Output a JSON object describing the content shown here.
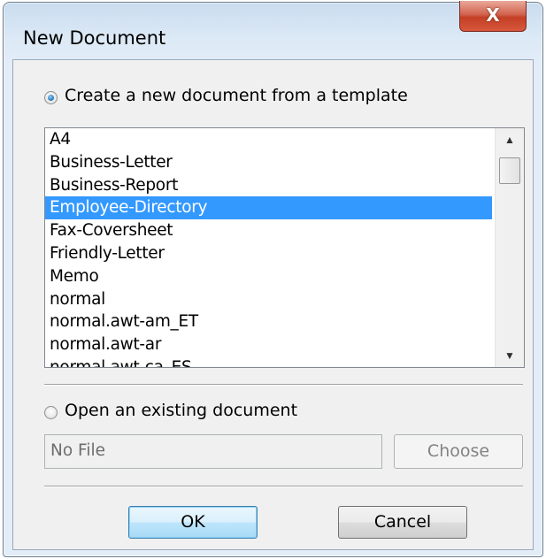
{
  "window": {
    "title": "New Document",
    "close_label": "X"
  },
  "options": {
    "template_label": "Create a new document from a template",
    "template_selected": true,
    "existing_label": "Open an existing document",
    "existing_selected": false
  },
  "template_list": {
    "items": [
      "A4",
      "Business-Letter",
      "Business-Report",
      "Employee-Directory",
      "Fax-Coversheet",
      "Friendly-Letter",
      "Memo",
      "normal",
      "normal.awt-am_ET",
      "normal.awt-ar",
      "normal.awt-ca_ES"
    ],
    "selected": "Employee-Directory",
    "scroll_up": "▲",
    "scroll_down": "▼"
  },
  "file": {
    "value": "No File",
    "choose_label": "Choose"
  },
  "buttons": {
    "ok_label": "OK",
    "cancel_label": "Cancel"
  }
}
